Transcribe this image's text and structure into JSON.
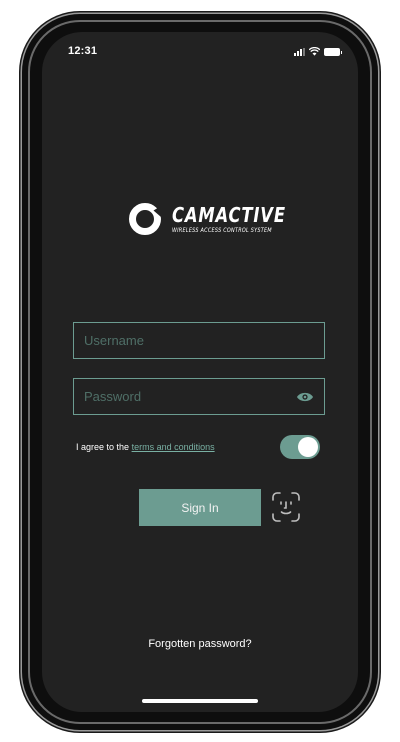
{
  "status_bar": {
    "time": "12:31"
  },
  "brand": {
    "name": "CAMACTIVE",
    "tagline": "WIRELESS ACCESS CONTROL SYSTEM"
  },
  "login": {
    "username": {
      "placeholder": "Username",
      "value": ""
    },
    "password": {
      "placeholder": "Password",
      "value": ""
    },
    "agree_prefix": "I agree to the",
    "terms_link": "terms and conditions",
    "agree_toggle_on": true,
    "sign_in_label": "Sign In",
    "forgot_password": "Forgotten password?"
  },
  "icons": {
    "eye": "eye-icon",
    "face_id": "face-id-icon",
    "signal": "cellular-signal-icon",
    "wifi": "wifi-icon",
    "battery": "battery-icon"
  },
  "colors": {
    "accent": "#6c9c91",
    "background": "#222222",
    "link": "#79b0a3"
  }
}
